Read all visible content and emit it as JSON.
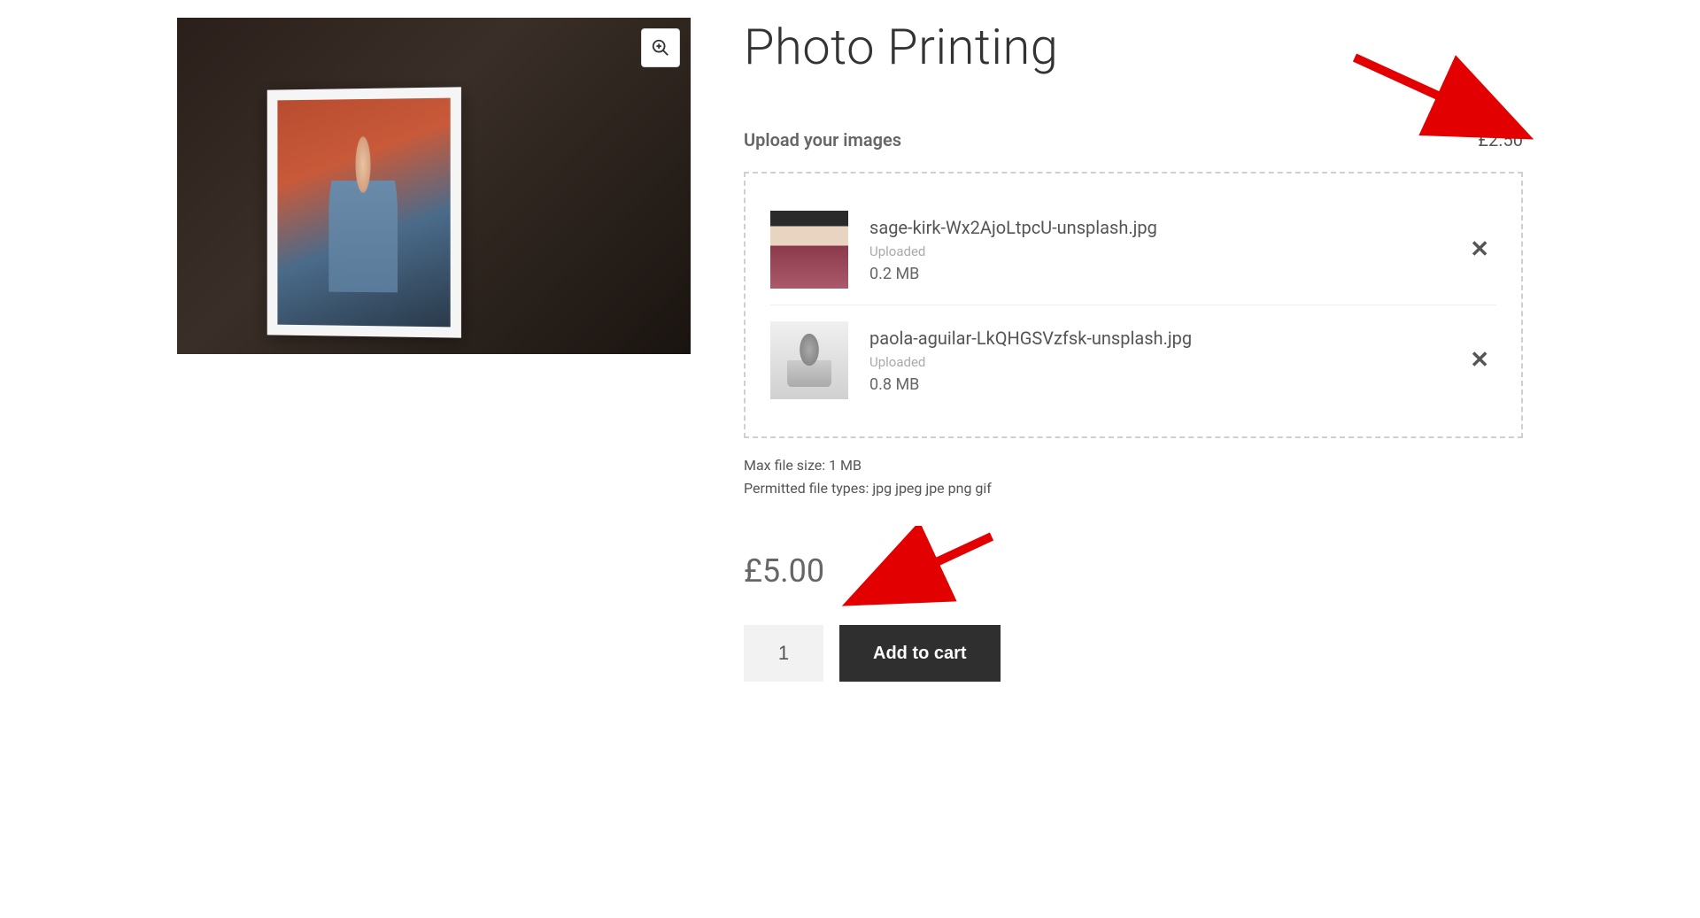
{
  "product": {
    "title": "Photo Printing",
    "upload_label": "Upload your images",
    "per_image_price": "£2.50",
    "total_price": "£5.00",
    "quantity": "1",
    "add_to_cart_label": "Add to cart"
  },
  "constraints": {
    "max_file_size": "Max file size: 1 MB",
    "permitted_types": "Permitted file types: jpg jpeg jpe png gif"
  },
  "files": [
    {
      "name": "sage-kirk-Wx2AjoLtpcU-unsplash.jpg",
      "status": "Uploaded",
      "size": "0.2 MB"
    },
    {
      "name": "paola-aguilar-LkQHGSVzfsk-unsplash.jpg",
      "status": "Uploaded",
      "size": "0.8 MB"
    }
  ]
}
